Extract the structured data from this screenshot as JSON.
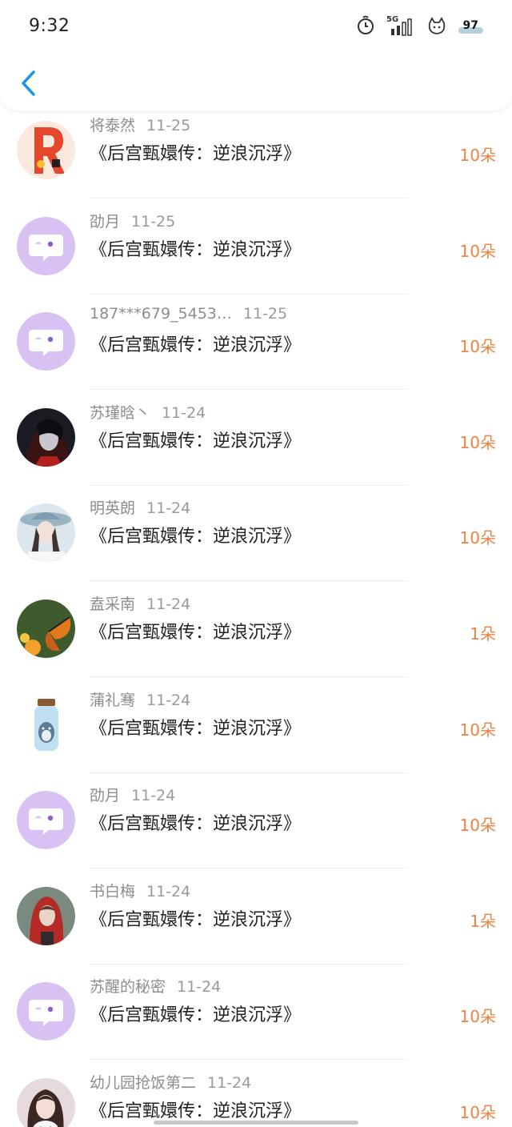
{
  "status": {
    "time": "9:32",
    "network": "5G",
    "battery": "97"
  },
  "colors": {
    "amount": "#ea8443",
    "avatar_default": "#d8c2f3",
    "back_arrow": "#1e96e6"
  },
  "rows": [
    {
      "name": "将泰然",
      "date": "11-25",
      "title": "《后宫甄嬛传：逆浪沉浮》",
      "amount": "10朵",
      "avatar": "letter-r"
    },
    {
      "name": "劭月",
      "date": "11-25",
      "title": "《后宫甄嬛传：逆浪沉浮》",
      "amount": "10朵",
      "avatar": "default"
    },
    {
      "name": "187***679_5453…",
      "date": "11-25",
      "title": "《后宫甄嬛传：逆浪沉浮》",
      "amount": "10朵",
      "avatar": "default"
    },
    {
      "name": "苏瑾晗丶",
      "date": "11-24",
      "title": "《后宫甄嬛传：逆浪沉浮》",
      "amount": "10朵",
      "avatar": "dark-portrait"
    },
    {
      "name": "明英朗",
      "date": "11-24",
      "title": "《后宫甄嬛传：逆浪沉浮》",
      "amount": "10朵",
      "avatar": "girl-hat"
    },
    {
      "name": "盍采南",
      "date": "11-24",
      "title": "《后宫甄嬛传：逆浪沉浮》",
      "amount": "1朵",
      "avatar": "butterfly"
    },
    {
      "name": "蒲礼骞",
      "date": "11-24",
      "title": "《后宫甄嬛传：逆浪沉浮》",
      "amount": "10朵",
      "avatar": "bottle"
    },
    {
      "name": "劭月",
      "date": "11-24",
      "title": "《后宫甄嬛传：逆浪沉浮》",
      "amount": "10朵",
      "avatar": "default"
    },
    {
      "name": "书白梅",
      "date": "11-24",
      "title": "《后宫甄嬛传：逆浪沉浮》",
      "amount": "1朵",
      "avatar": "red-hood"
    },
    {
      "name": "苏醒的秘密",
      "date": "11-24",
      "title": "《后宫甄嬛传：逆浪沉浮》",
      "amount": "10朵",
      "avatar": "default"
    },
    {
      "name": "幼儿园抢饭第二",
      "date": "11-24",
      "title": "《后宫甄嬛传：逆浪沉浮》",
      "amount": "10朵",
      "avatar": "girl-cat"
    }
  ]
}
